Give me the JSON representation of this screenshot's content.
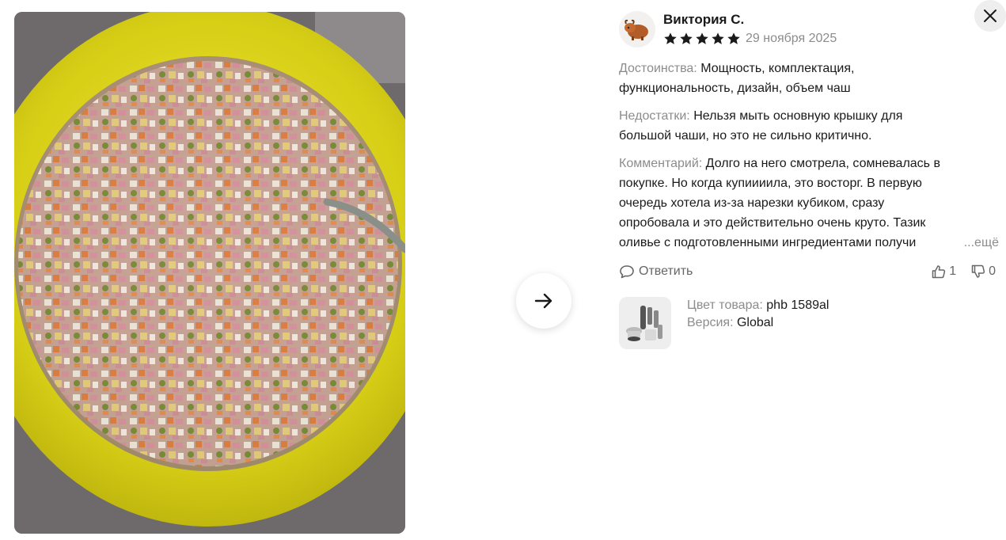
{
  "author": {
    "name": "Виктория С.",
    "rating": 5,
    "max_rating": 5,
    "date": "29 ноября 2025"
  },
  "review": {
    "pros_label": "Достоинства:",
    "pros_line1": "Мощность, комплектация,",
    "pros_line2": "функциональность, дизайн, объем чаш",
    "cons_label": "Недостатки:",
    "cons_line1": "Нельзя мыть основную крышку для",
    "cons_line2": "большой чаши, но это не сильно критично.",
    "comment_label": "Комментарий:",
    "comment_line1": "Долго на него смотрела, сомневалась в",
    "comment_line2": "покупке. Но когда купиииила, это восторг. В первую",
    "comment_line3": "очередь хотела из-за нарезки кубиком, сразу",
    "comment_line4": "опробовала и это действительно очень круто. Тазик",
    "comment_line5": "оливье с подготовленными ингредиентами получи",
    "more_label": "...ещё"
  },
  "actions": {
    "reply_label": "Ответить",
    "likes": "1",
    "dislikes": "0"
  },
  "product": {
    "color_label": "Цвет товара:",
    "color_value": "phb 1589al",
    "version_label": "Версия:",
    "version_value": "Global"
  },
  "icons": {
    "next": "arrow-right-icon",
    "close": "close-icon",
    "reply": "speech-bubble-icon",
    "like": "thumbs-up-icon",
    "dislike": "thumbs-down-icon",
    "star": "star-icon"
  },
  "colors": {
    "star": "#1a1a1a",
    "muted_text": "#8c8c8c",
    "bowl_yellow": "#d8d21a"
  }
}
